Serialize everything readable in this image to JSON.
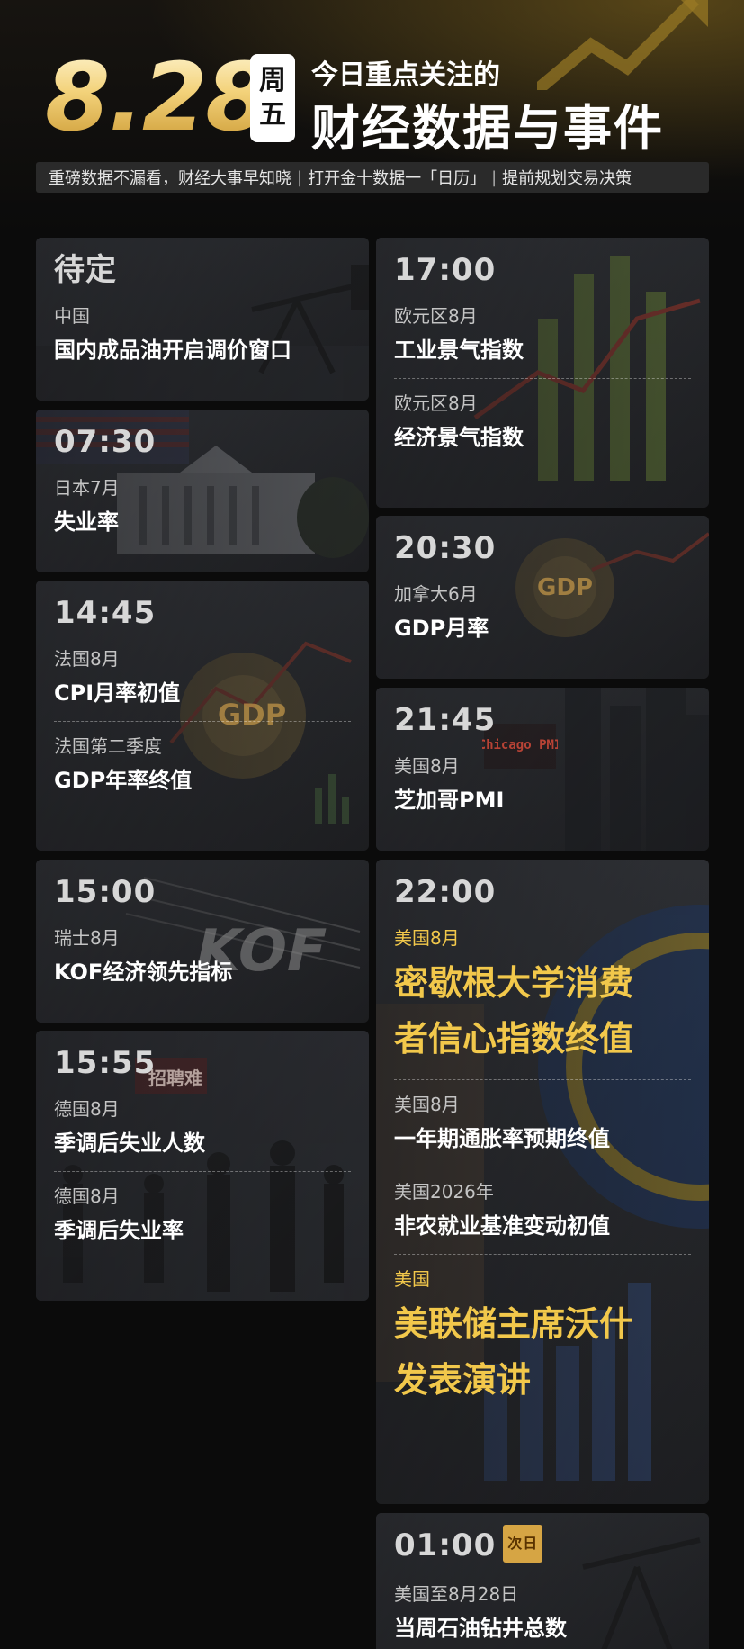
{
  "header": {
    "date": "8.28",
    "weekday": [
      "周",
      "五"
    ],
    "line1": "今日重点关注的",
    "line2": "财经数据与事件"
  },
  "subbar": {
    "parts": [
      "重磅数据不漏看，财经大事早知晓",
      "打开金十数据一「日历」",
      "提前规划交易决策"
    ],
    "separator": "|"
  },
  "left_cards": [
    {
      "time": "待定",
      "items": [
        {
          "region": "中国",
          "event": "国内成品油开启调价窗口"
        }
      ]
    },
    {
      "time": "07:30",
      "items": [
        {
          "region": "日本7月",
          "event": "失业率"
        }
      ]
    },
    {
      "time": "14:45",
      "items": [
        {
          "region": "法国8月",
          "event": "CPI月率初值"
        },
        {
          "region": "法国第二季度",
          "event": "GDP年率终值"
        }
      ]
    },
    {
      "time": "15:00",
      "items": [
        {
          "region": "瑞士8月",
          "event": "KOF经济领先指标"
        }
      ]
    },
    {
      "time": "15:55",
      "items": [
        {
          "region": "德国8月",
          "event": "季调后失业人数"
        },
        {
          "region": "德国8月",
          "event": "季调后失业率"
        }
      ]
    }
  ],
  "right_cards": [
    {
      "time": "17:00",
      "items": [
        {
          "region": "欧元区8月",
          "event": "工业景气指数"
        },
        {
          "region": "欧元区8月",
          "event": "经济景气指数"
        }
      ]
    },
    {
      "time": "20:30",
      "items": [
        {
          "region": "加拿大6月",
          "event": "GDP月率"
        }
      ]
    },
    {
      "time": "21:45",
      "items": [
        {
          "region": "美国8月",
          "event": "芝加哥PMI"
        }
      ]
    },
    {
      "time": "22:00",
      "items": [
        {
          "region": "美国8月",
          "event_lines": [
            "密歇根大学消费",
            "者信心指数终值"
          ],
          "highlight": true
        },
        {
          "region": "美国8月",
          "event": "一年期通胀率预期终值"
        },
        {
          "region": "美国2026年",
          "event": "非农就业基准变动初值"
        },
        {
          "region": "美国",
          "event_lines": [
            "美联储主席沃什",
            "发表演讲"
          ],
          "highlight": true
        }
      ]
    },
    {
      "time": "01:00",
      "badge": "次日",
      "items": [
        {
          "region": "美国至8月28日",
          "event": "当周石油钻井总数"
        }
      ]
    }
  ],
  "image_texts": {
    "chicago_sign": "Chicago PMI",
    "gdp_coin": "GDP",
    "kof_letters": "KOF",
    "recruit_sign": "招聘难"
  },
  "colors": {
    "accent_gold": "#f2c84b",
    "badge_bg": "#d6a544",
    "background": "#0b0b0b"
  }
}
